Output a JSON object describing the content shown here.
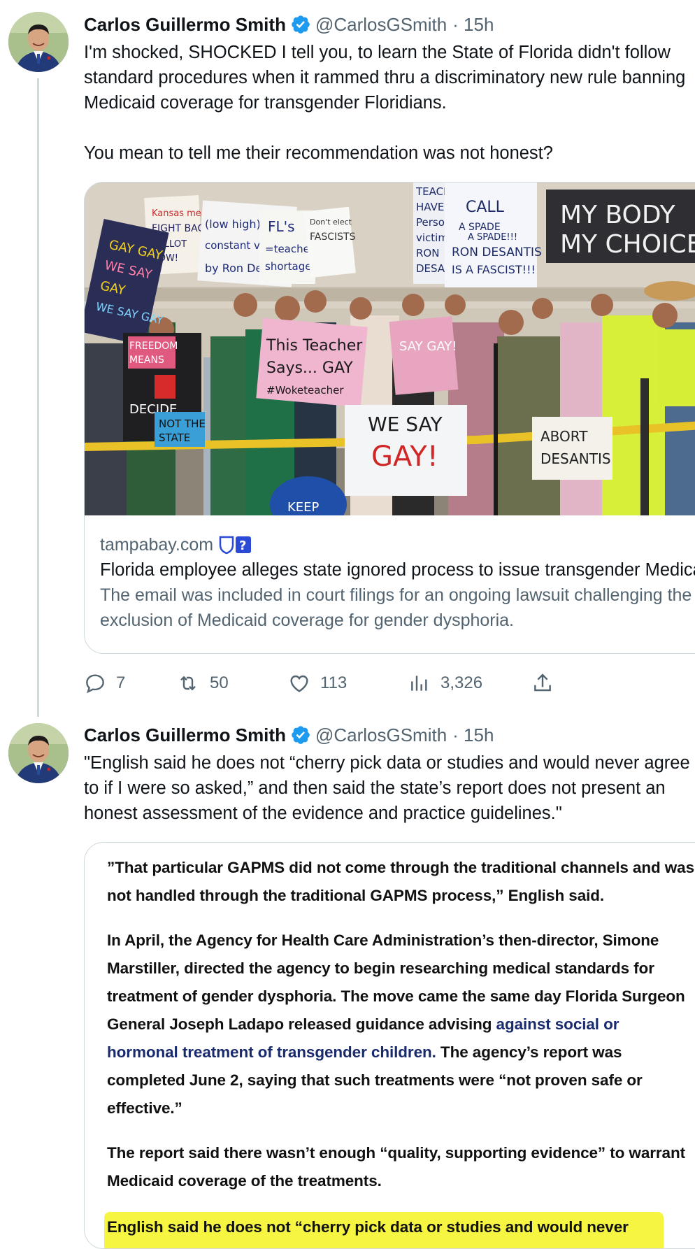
{
  "tweet1": {
    "name": "Carlos Guillermo Smith",
    "handle": "@CarlosGSmith",
    "time": "· 15h",
    "text": "I'm shocked, SHOCKED I tell you, to learn the State of Florida didn't follow standard procedures when it rammed thru a discriminatory new rule banning Medicaid coverage for transgender Floridians.\n\nYou mean to tell me their recommendation was not honest?",
    "card": {
      "domain": "tampabay.com",
      "title": "Florida employee alleges state ignored process to issue transgender Medicaid rule",
      "description": "The email was included in court filings for an ongoing lawsuit challenging the exclusion of Medicaid coverage for gender dysphoria.",
      "signs": {
        "kansas": "Kansas means FIGHT BACK! BALLOT INITIATIVE NOW!",
        "gun": "(low high) gun (pay stress) reform constant vilification by Ron DeSantis",
        "fl": "FL's =teacher shortage",
        "fascist_small": "Don't elect FASCISTS",
        "spade1": "TEACH HAVE Person victim BY RON DESAN",
        "spade2": "CALL A SPADE A SPADE!!! RON DESANTIS IS A FASCIST!!!",
        "mybody": "MY BODY MY CHOICE",
        "gay": "GAY GAY GAY WE SAY GAY WE SAY GAY",
        "freedom": "FREEDOM MEANS I DECIDE",
        "notstate": "NOT THE STATE",
        "teacher": "This Teacher Says... GAY #Woketeacher",
        "wesay": "WE SAY GAY!",
        "abort": "ABORT DESANTIS",
        "keep": "KEEP"
      }
    },
    "stats": {
      "replies": "7",
      "retweets": "50",
      "likes": "113",
      "views": "3,326"
    }
  },
  "tweet2": {
    "name": "Carlos Guillermo Smith",
    "handle": "@CarlosGSmith",
    "time": "· 15h",
    "text": "\"English said he does not “cherry pick data or studies and would never agree to if I were so asked,” and then said the state’s report does not present an honest assessment of the evidence and practice guidelines.\"",
    "quote": {
      "p1": "”That particular GAPMS did not come through the traditional channels and was not handled through the traditional GAPMS process,” English said.",
      "p2a": "In April, the Agency for Health Care Administration’s then-director, Simone Marstiller, directed the agency to begin researching medical standards for treatment of gender dysphoria. The move came the same day Florida Surgeon General Joseph Ladapo released guidance advising ",
      "p2link": "against social or hormonal treatment of transgender children.",
      "p2b": " The agency’s report was completed June 2, saying that such treatments were “not proven safe or effective.”",
      "p3": "The report said there wasn’t enough “quality, supporting evidence” to warrant Medicaid coverage of the treatments.",
      "p4": "English said he does not “cherry pick data or studies and would never"
    }
  },
  "colors": {
    "verified": "#1d9bf0",
    "muted": "#536471",
    "highlight": "#f5f542"
  }
}
